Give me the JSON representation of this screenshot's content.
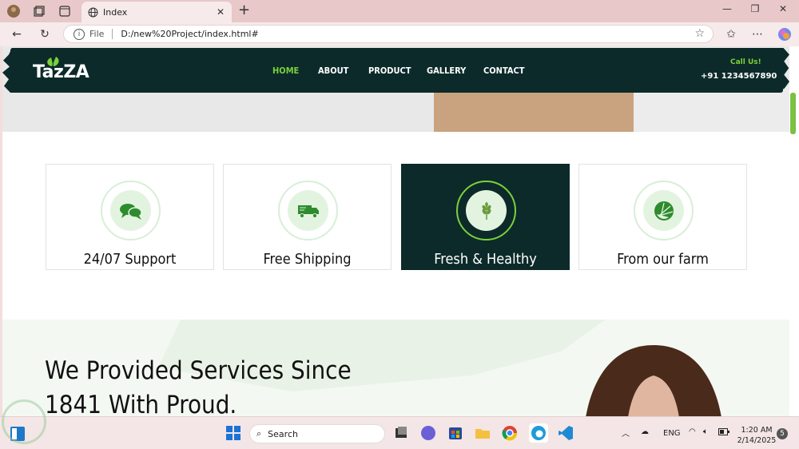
{
  "browser": {
    "tab_title": "Index",
    "address_prefix": "File",
    "url": "D:/new%20Project/index.html#"
  },
  "site": {
    "logo": "TazZA",
    "nav": [
      "HOME",
      "ABOUT",
      "PRODUCT",
      "GALLERY",
      "CONTACT"
    ],
    "active_nav": "HOME",
    "call_label": "Call Us!",
    "phone": "+91 1234567890"
  },
  "features": [
    {
      "label": "24/07 Support",
      "icon": "chat-icon"
    },
    {
      "label": "Free Shipping",
      "icon": "truck-icon"
    },
    {
      "label": "Fresh & Healthy",
      "icon": "wheat-icon"
    },
    {
      "label": "From our farm",
      "icon": "lime-icon"
    }
  ],
  "about": {
    "title_line1": "We Provided Services Since",
    "title_line2": "1841 With Proud."
  },
  "taskbar": {
    "search_placeholder": "Search",
    "lang": "ENG",
    "time": "1:20 AM",
    "date": "2/14/2025",
    "notifications": "5"
  },
  "colors": {
    "accent": "#7bd13a",
    "dark": "#0d2a2a"
  }
}
